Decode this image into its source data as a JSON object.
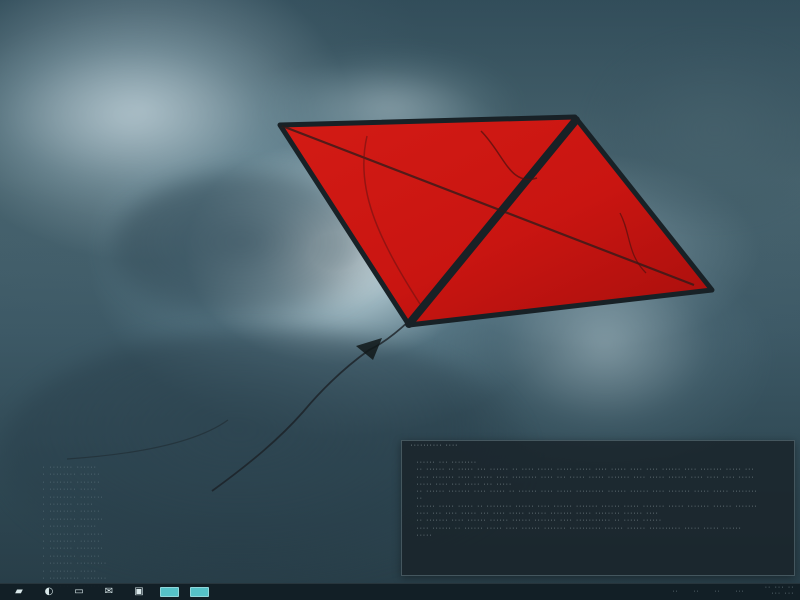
{
  "desktop": {
    "background_colors": {
      "sky_dark": "#2d4551",
      "sky_light": "#a8c0c8",
      "kite_red": "#c71612",
      "kite_frame": "#182126"
    },
    "left_list": [
      "· ······· ······",
      "· ········ ······",
      "· ······· ·······",
      "· ········ ·····",
      "· ········ ·······",
      "· ······· ·····",
      "· ········ ······",
      "· ········ ·······",
      "· ······ ·······",
      "· ········· ······",
      "· ········ ······",
      "· ······· ········",
      "· ········ ······",
      "· ······· ·········",
      "· ········ ·····",
      "· ········· ·······",
      "· ········ ·······"
    ]
  },
  "terminal": {
    "title": "·········· ····",
    "lines": [
      "······ ··· ········",
      "·· ······ ·· ····· ··· ······ ·· ···· ····· ····· ····· ···· ····· ···· ···· ······ ···· ······· ····· ···",
      "···· ······· ···· ······ ···· ········ ···· ··· ····· ····· ······· ···· ····· ······ ···· ···· ···· ·····",
      "····· ···· ··· ····· ··· ·····",
      "·· ······ ······· ···· ····· ·· ······ ···· ····· ········· ······ ······ ···· ······· ····· ····· ········",
      "··",
      "······ ····· ····· ·· ········ ······ ···· ······ ······· ······ ····· ······· ····· ······· ······ ·······",
      "···· ··· ···· ····· ··· ···· ····· ······ ······· ····· ········ ······ ····",
      "·· ······· ···· ······ ······ ······ ······· ···· ··········· ·· ····· ······",
      "···· ······ ·· ······ ····· ···· ······ ······· ·········· ······ ······ ·········· ····· ····· ······",
      "·····"
    ]
  },
  "taskbar": {
    "start_icon": "start-menu-icon",
    "buttons": [
      {
        "name": "start-menu-button",
        "glyph": "▰"
      },
      {
        "name": "browser-button",
        "glyph": "◐"
      },
      {
        "name": "file-manager-button",
        "glyph": "▭"
      },
      {
        "name": "mail-button",
        "glyph": "✉"
      },
      {
        "name": "terminal-button",
        "glyph": "▣"
      }
    ],
    "apps": [
      {
        "name": "active-app-1"
      },
      {
        "name": "active-app-2"
      }
    ],
    "tray_items": [
      "··",
      "··",
      "··",
      "···"
    ],
    "clock": {
      "line1": "·· ··· ··",
      "line2": "··· ···"
    }
  }
}
